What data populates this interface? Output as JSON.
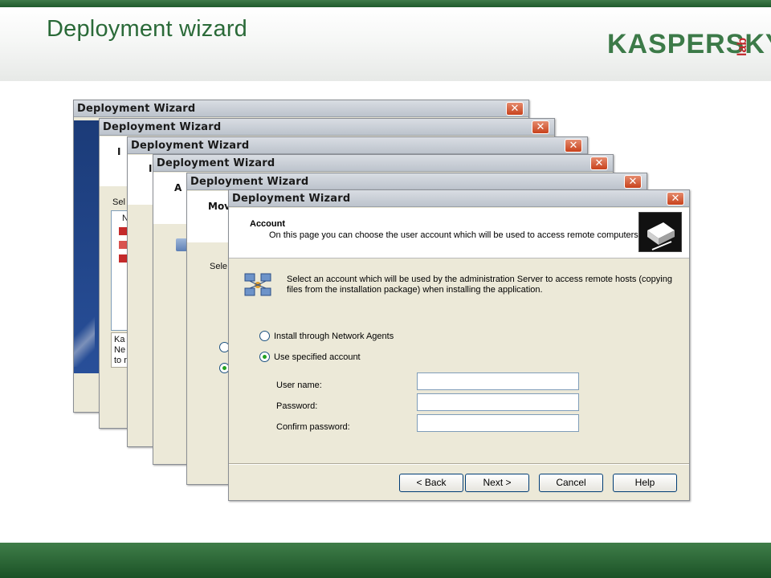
{
  "slide": {
    "title": "Deployment wizard",
    "logo_main": "KASPERSKY",
    "logo_lab": "lab"
  },
  "colors": {
    "green_dark": "#1f5a2c",
    "green_title": "#2a6a38",
    "close_red": "#c8421c",
    "radio_green": "#21a121"
  },
  "icons": {
    "close": "close-icon",
    "network": "network-computers-icon",
    "wizard": "wizard-header-icon"
  },
  "stack_windows": [
    {
      "title": "Deployment Wizard",
      "close": "✕"
    },
    {
      "title": "Deployment Wizard",
      "close": "✕"
    },
    {
      "title": "Deployment Wizard",
      "close": "✕"
    },
    {
      "title": "Deployment Wizard",
      "close": "✕"
    },
    {
      "title": "Deployment Wizard",
      "close": "✕"
    }
  ],
  "back_fragments": {
    "w2_letter": "I",
    "w2_sel": "Sel",
    "w2_n": "N",
    "w2_k1": "Ka",
    "w2_k2": "Ne",
    "w2_k3": "to r",
    "w3_letter": "I",
    "w4_letter": "A",
    "w5_letter": "Mov",
    "w5_sel": "Sele"
  },
  "dialog": {
    "title": "Deployment Wizard",
    "close": "✕",
    "header_title": "Account",
    "header_desc": "On this page you can choose the user account which will be used to access  remote computers",
    "intro": "Select an account which will be used by the administration Server to access remote hosts (copying files from the installation package) when installing the application.",
    "options": [
      {
        "label": "Install through Network Agents",
        "selected": false
      },
      {
        "label": "Use specified account",
        "selected": true
      }
    ],
    "fields": [
      {
        "label": "User name:",
        "value": ""
      },
      {
        "label": "Password:",
        "value": ""
      },
      {
        "label": "Confirm password:",
        "value": ""
      }
    ],
    "buttons": {
      "back": "< Back",
      "next": "Next >",
      "cancel": "Cancel",
      "help": "Help"
    }
  }
}
